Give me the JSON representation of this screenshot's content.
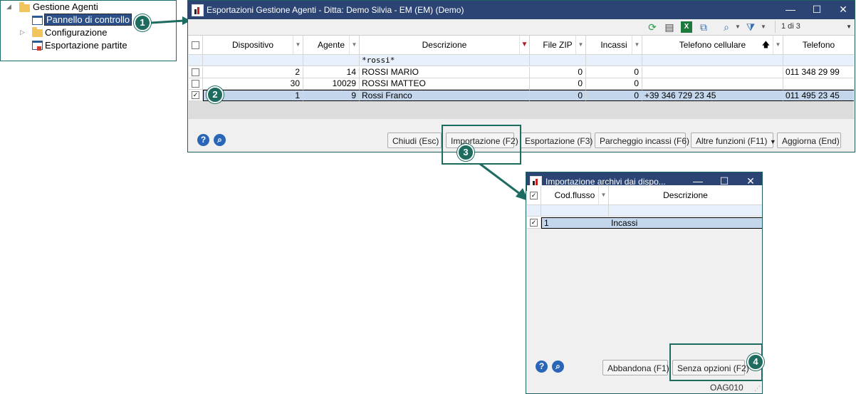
{
  "tree": {
    "root": "Gestione Agenti",
    "items": [
      {
        "label": "Pannello di controllo"
      },
      {
        "label": "Configurazione"
      },
      {
        "label": "Esportazione partite"
      }
    ]
  },
  "callouts": [
    "1",
    "2",
    "3",
    "4"
  ],
  "main_window": {
    "title": "Esportazioni Gestione Agenti - Ditta: Demo Silvia - EM (EM)  (Demo)",
    "page_indicator": "1 di 3",
    "columns": [
      "Dispositivo",
      "Agente",
      "Descrizione",
      "File ZIP",
      "Incassi",
      "Telefono cellulare",
      "Telefono"
    ],
    "filter_text": "*rossi*",
    "rows": [
      {
        "checked": "",
        "dispositivo": "2",
        "agente": "14",
        "descrizione": "ROSSI MARIO",
        "file_zip": "0",
        "incassi": "0",
        "cellulare": "",
        "telefono": "011 348 29 99"
      },
      {
        "checked": "",
        "dispositivo": "30",
        "agente": "10029",
        "descrizione": "ROSSI MATTEO",
        "file_zip": "0",
        "incassi": "0",
        "cellulare": "",
        "telefono": ""
      },
      {
        "checked": "✓",
        "dispositivo": "1",
        "agente": "9",
        "descrizione": "Rossi Franco",
        "file_zip": "0",
        "incassi": "0",
        "cellulare": "+39 346 729 23 45",
        "telefono": "011 495 23 45"
      }
    ],
    "buttons": {
      "chiudi": "Chiudi (Esc)",
      "importazione": "Importazione (F2)",
      "esportazione": "Esportazione (F3)",
      "parcheggio": "Parcheggio incassi (F6)",
      "altre": "Altre funzioni (F11)",
      "aggiorna": "Aggiorna (End)"
    }
  },
  "import_window": {
    "title": "Importazione archivi dai dispo...",
    "columns": [
      "Cod.flusso",
      "Descrizione"
    ],
    "rows": [
      {
        "checked": "✓",
        "cod": "1",
        "descrizione": "Incassi"
      }
    ],
    "buttons": {
      "abbandona": "Abbandona (F1)",
      "senza_opzioni": "Senza opzioni (F2)"
    },
    "status_code": "OAG010"
  },
  "colors": {
    "titlebar": "#2b4474",
    "callout": "#1e6b5f",
    "selected_row": "#c3d6ec"
  }
}
